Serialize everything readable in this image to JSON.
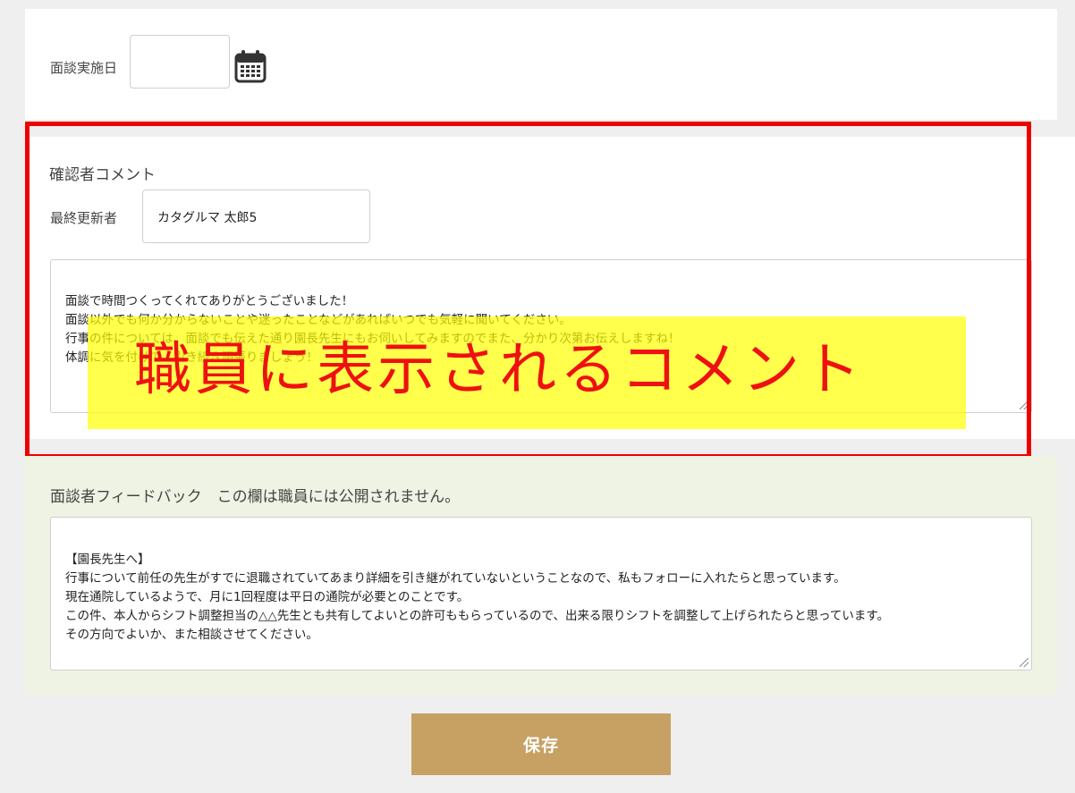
{
  "interview": {
    "date_label": "面談実施日",
    "date_value": ""
  },
  "comment": {
    "section_title": "確認者コメント",
    "updater_label": "最終更新者",
    "updater_value": "カタグルマ 太郎5",
    "text": "面談で時間つくってくれてありがとうございました！\n面談以外でも何か分からないことや迷ったことなどがあればいつでも気軽に聞いてください。\n行事の件については、面談でも伝えた通り園長先生にもお伺いしてみますのでまた、分かり次第お伝えしますね！\n体調に気を付けて、引き続き頑張りましょう！"
  },
  "annotation": {
    "overlay_text": "職員に表示されるコメント",
    "frame_color": "#ee0000",
    "highlight_color": "#ffff00"
  },
  "feedback": {
    "section_title": "面談者フィードバック　この欄は職員には公開されません。",
    "text": "【園長先生へ】\n行事について前任の先生がすでに退職されていてあまり詳細を引き継がれていないということなので、私もフォローに入れたらと思っています。\n現在通院しているようで、月に1回程度は平日の通院が必要とのことです。\nこの件、本人からシフト調整担当の△△先生とも共有してよいとの許可ももらっているので、出来る限りシフトを調整して上げられたらと思っています。\nその方向でよいか、また相談させてください。"
  },
  "actions": {
    "save_label": "保存",
    "save_color": "#c7a163"
  },
  "icons": {
    "calendar": "calendar-icon"
  }
}
